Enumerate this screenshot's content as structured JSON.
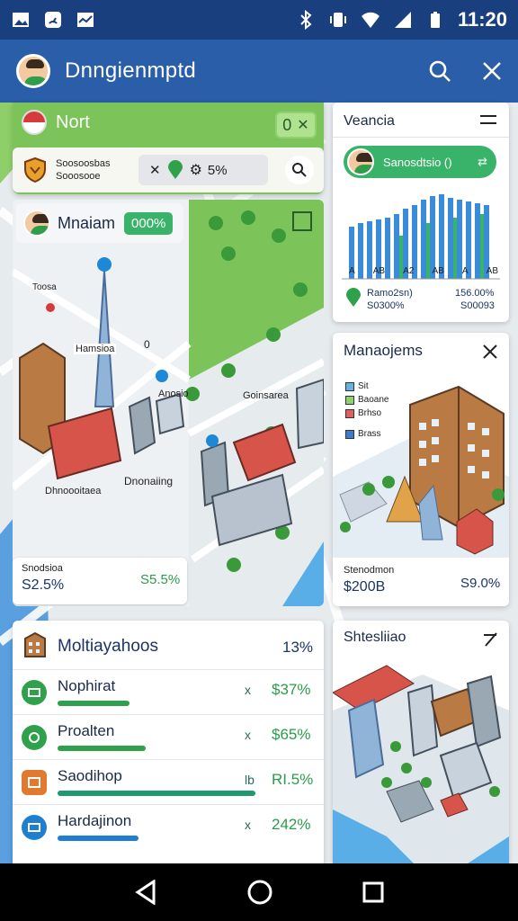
{
  "status_bar": {
    "time": "11:20",
    "left_icons": [
      "image-icon",
      "gauge-icon",
      "trend-icon"
    ],
    "right_icons": [
      "bluetooth-icon",
      "vibrate-icon",
      "wifi-icon",
      "signal-icon",
      "battery-icon"
    ]
  },
  "app_bar": {
    "title": "Dnngienmptd",
    "search_icon": "search-icon",
    "close_icon": "close-icon"
  },
  "top_left_panel": {
    "title": "Nort",
    "badge": "0",
    "filter_label_line1": "Soosoosbas",
    "filter_label_line2": "Sooosooe",
    "filter_value": "5%",
    "search_icon": "search-icon"
  },
  "mission_card": {
    "title": "Mnaiam",
    "badge": "000%",
    "map_labels": [
      "Toosa",
      "Hamsioa",
      "0",
      "Anosio",
      "Goinsarea",
      "Dnonaiing",
      "Dhnoooitaea"
    ],
    "footer_label": "Snodsioa",
    "footer_value_left": "S2.5%",
    "footer_value_right": "S5.5%"
  },
  "vendia_card": {
    "title": "Veancia",
    "profile_label": "Sanosdtsio ()",
    "axis_labels": [
      "A",
      "AB",
      "A2",
      "AB",
      "A",
      "AB"
    ],
    "legend_left_line1": "Ramo2sn)",
    "legend_left_line2": "S0300%",
    "legend_right_line1": "156.00%",
    "legend_right_line2": "S00093"
  },
  "management_card": {
    "title": "Manaojems",
    "legend": [
      "Sit",
      "Baoane",
      "Brhso",
      "Brass"
    ],
    "footer_label": "Stenodmon",
    "footer_value_left": "$200B",
    "footer_value_right": "S9.0%"
  },
  "list_panel": {
    "title": "Moltiayahoos",
    "title_value": "13%",
    "items": [
      {
        "label": "Nophirat",
        "marker": "x",
        "value": "$37%",
        "icon": "badge-icon",
        "color": "#2fa04b",
        "bar": 0.35
      },
      {
        "label": "Proalten",
        "marker": "x",
        "value": "$65%",
        "icon": "user-icon",
        "color": "#2fa04b",
        "bar": 0.42
      },
      {
        "label": "Saodihop",
        "marker": "lb",
        "value": "RI.5%",
        "icon": "store-icon",
        "color": "#e07a30",
        "bar": 0.95
      },
      {
        "label": "Hardajinon",
        "marker": "x",
        "value": "242%",
        "icon": "chart-icon",
        "color": "#1e7fd0",
        "bar": 0.4
      }
    ]
  },
  "buildings_card": {
    "title": "Shtesliiao"
  },
  "nav_bar": {
    "back_icon": "back-icon",
    "home_icon": "home-icon",
    "recents_icon": "recents-icon"
  }
}
